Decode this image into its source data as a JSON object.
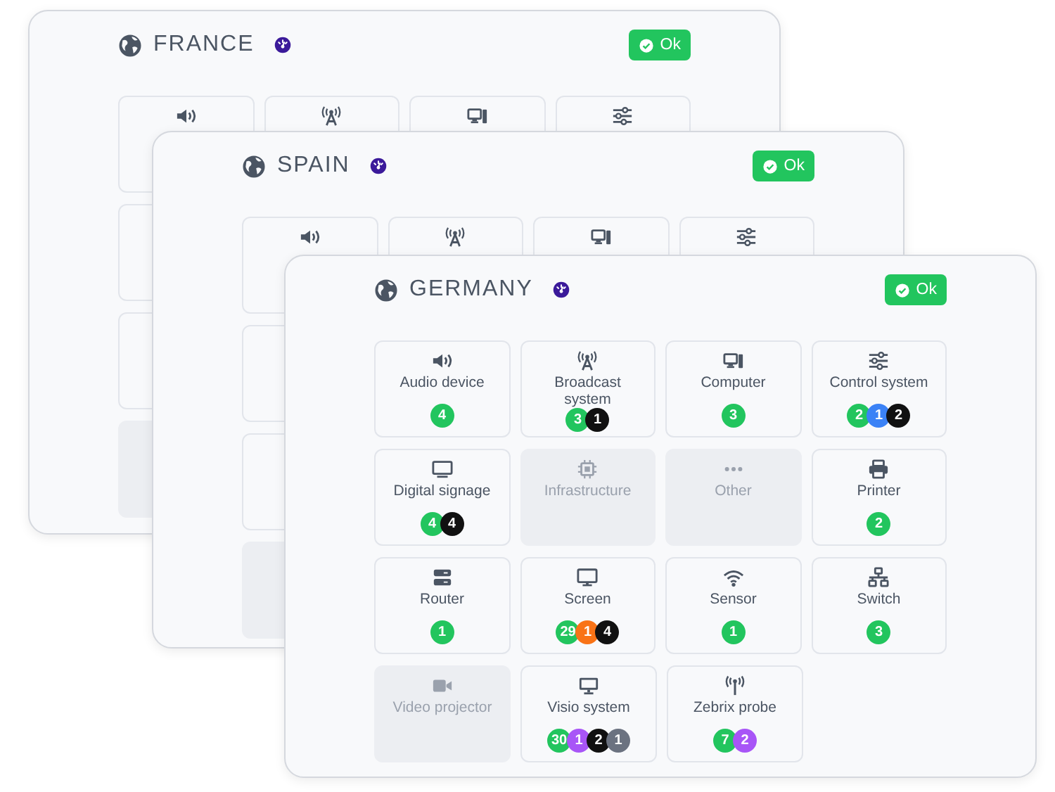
{
  "cards": [
    {
      "country": "FRANCE",
      "button": "Ok",
      "rows": [
        {
          "tiles": [
            {
              "kind": "audio",
              "disabled": false
            },
            {
              "kind": "broadcast",
              "disabled": false
            },
            {
              "kind": "computer",
              "disabled": false
            },
            {
              "kind": "control",
              "disabled": false
            }
          ]
        },
        {
          "tiles": [
            {
              "disabled": false
            }
          ]
        },
        {
          "tiles": [
            {
              "disabled": false
            }
          ]
        },
        {
          "tiles": [
            {
              "disabled": true
            }
          ]
        }
      ]
    },
    {
      "country": "SPAIN",
      "button": "Ok",
      "rows": [
        {
          "tiles": [
            {
              "kind": "audio",
              "disabled": false
            },
            {
              "kind": "broadcast",
              "disabled": false
            },
            {
              "kind": "computer",
              "disabled": false
            },
            {
              "kind": "control",
              "disabled": false
            }
          ]
        },
        {
          "tiles": [
            {
              "disabled": false
            }
          ]
        },
        {
          "tiles": [
            {
              "disabled": false
            }
          ]
        },
        {
          "tiles": [
            {
              "disabled": true
            }
          ]
        }
      ]
    },
    {
      "country": "GERMANY",
      "button": "Ok",
      "rows": [
        {
          "tiles": [
            {
              "kind": "audio",
              "label": "Audio device",
              "disabled": false,
              "counts": [
                {
                  "value": "4",
                  "color": "#22c55e"
                }
              ]
            },
            {
              "kind": "broadcast",
              "label": "Broadcast system",
              "disabled": false,
              "counts": [
                {
                  "value": "3",
                  "color": "#22c55e"
                },
                {
                  "value": "1",
                  "color": "#111111"
                }
              ]
            },
            {
              "kind": "computer",
              "label": "Computer",
              "disabled": false,
              "counts": [
                {
                  "value": "3",
                  "color": "#22c55e"
                }
              ]
            },
            {
              "kind": "control",
              "label": "Control system",
              "disabled": false,
              "counts": [
                {
                  "value": "2",
                  "color": "#22c55e"
                },
                {
                  "value": "1",
                  "color": "#3b82f6"
                },
                {
                  "value": "2",
                  "color": "#111111"
                }
              ]
            }
          ]
        },
        {
          "tiles": [
            {
              "kind": "signage",
              "label": "Digital signage",
              "disabled": false,
              "counts": [
                {
                  "value": "4",
                  "color": "#22c55e"
                },
                {
                  "value": "4",
                  "color": "#111111"
                }
              ]
            },
            {
              "kind": "infrastructure",
              "label": "Infrastructure",
              "disabled": true
            },
            {
              "kind": "other",
              "label": "Other",
              "disabled": true
            },
            {
              "kind": "printer",
              "label": "Printer",
              "disabled": false,
              "counts": [
                {
                  "value": "2",
                  "color": "#22c55e"
                }
              ]
            }
          ]
        },
        {
          "tiles": [
            {
              "kind": "router",
              "label": "Router",
              "disabled": false,
              "counts": [
                {
                  "value": "1",
                  "color": "#22c55e"
                }
              ]
            },
            {
              "kind": "screen",
              "label": "Screen",
              "disabled": false,
              "counts": [
                {
                  "value": "29",
                  "color": "#22c55e"
                },
                {
                  "value": "1",
                  "color": "#f97316"
                },
                {
                  "value": "4",
                  "color": "#111111"
                }
              ]
            },
            {
              "kind": "sensor",
              "label": "Sensor",
              "disabled": false,
              "counts": [
                {
                  "value": "1",
                  "color": "#22c55e"
                }
              ]
            },
            {
              "kind": "switch",
              "label": "Switch",
              "disabled": false,
              "counts": [
                {
                  "value": "3",
                  "color": "#22c55e"
                }
              ]
            }
          ]
        },
        {
          "tiles": [
            {
              "kind": "projector",
              "label": "Video projector",
              "disabled": true
            },
            {
              "kind": "visio",
              "label": "Visio system",
              "disabled": false,
              "counts": [
                {
                  "value": "30",
                  "color": "#22c55e"
                },
                {
                  "value": "1",
                  "color": "#a855f7"
                },
                {
                  "value": "2",
                  "color": "#111111"
                },
                {
                  "value": "1",
                  "color": "#6b7280"
                }
              ]
            },
            {
              "kind": "probe",
              "label": "Zebrix probe",
              "disabled": false,
              "counts": [
                {
                  "value": "7",
                  "color": "#22c55e"
                },
                {
                  "value": "2",
                  "color": "#a855f7"
                }
              ]
            }
          ]
        }
      ]
    }
  ]
}
